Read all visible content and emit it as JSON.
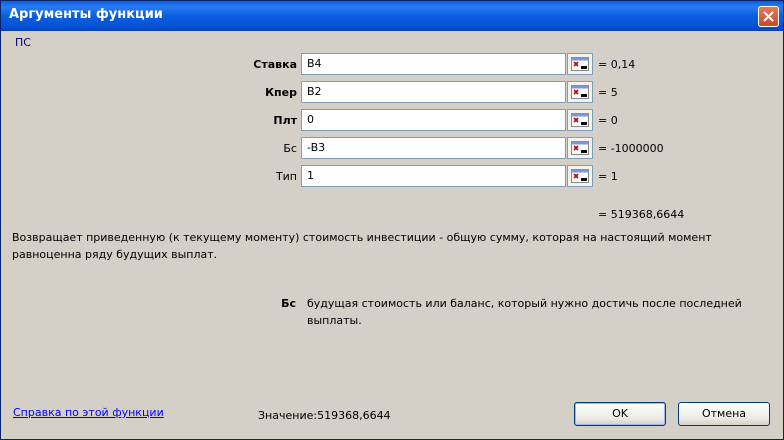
{
  "window": {
    "title": "Аргументы функции"
  },
  "function_name": "ПС",
  "arguments": [
    {
      "label": "Ставка",
      "bold": true,
      "input": "B4",
      "result": "= 0,14"
    },
    {
      "label": "Кпер",
      "bold": true,
      "input": "B2",
      "result": "= 5"
    },
    {
      "label": "Плт",
      "bold": true,
      "input": "0",
      "result": "= 0"
    },
    {
      "label": "Бс",
      "bold": false,
      "input": "-B3",
      "result": "= -1000000"
    },
    {
      "label": "Тип",
      "bold": false,
      "input": "1",
      "result": "= 1"
    }
  ],
  "formula_result": "= 519368,6644",
  "description": "Возвращает приведенную (к текущему моменту) стоимость инвестиции - общую сумму, которая на настоящий момент равноценна ряду будущих выплат.",
  "argument_help": {
    "name": "Бс",
    "text": "будущая стоимость или баланс, который нужно достичь после последней выплаты."
  },
  "footer": {
    "help_link": "Справка по этой функции",
    "value_label": "Значение:",
    "value": "519368,6644",
    "ok_label": "OK",
    "cancel_label": "Отмена"
  },
  "icons": {
    "close": "close-icon",
    "collapse": "collapse-dialog-icon"
  },
  "colors": {
    "title_bar": "#0a5ee0",
    "function_name": "#00007b",
    "link": "#0000ff",
    "dialog_bg": "#d4d0c8"
  }
}
